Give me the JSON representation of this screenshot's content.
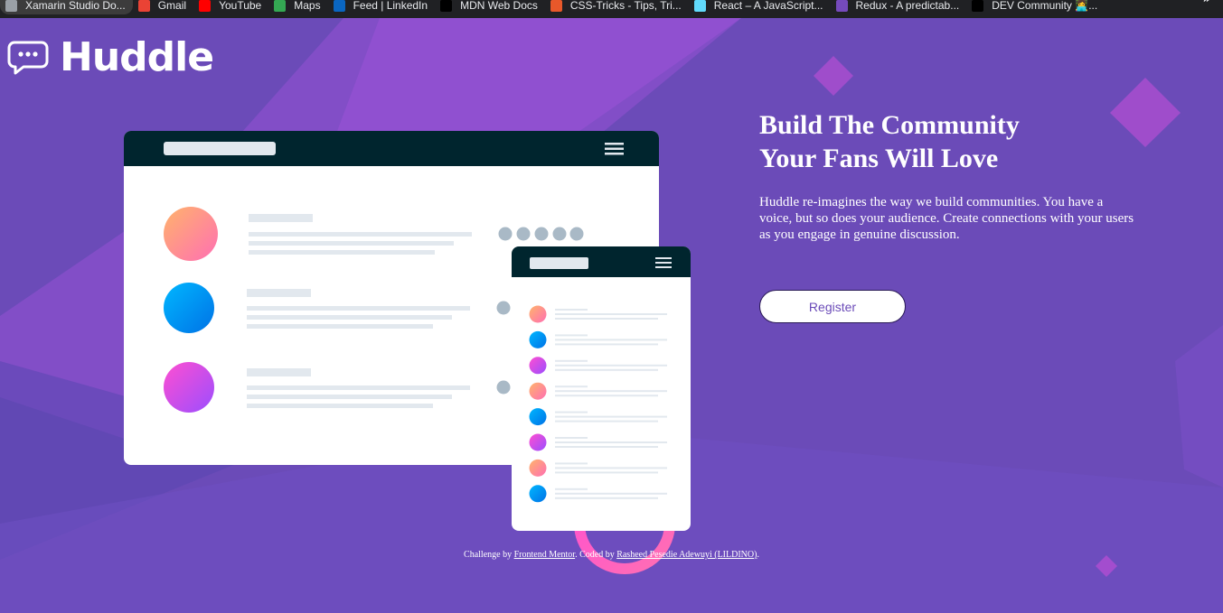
{
  "bookmarks": [
    {
      "label": "Xamarin Studio Do...",
      "icon": "globe-icon",
      "color": "#9aa0a6"
    },
    {
      "label": "Gmail",
      "icon": "gmail-icon",
      "color": "#ea4335"
    },
    {
      "label": "YouTube",
      "icon": "youtube-icon",
      "color": "#ff0000"
    },
    {
      "label": "Maps",
      "icon": "maps-icon",
      "color": "#34a853"
    },
    {
      "label": "Feed | LinkedIn",
      "icon": "linkedin-icon",
      "color": "#0a66c2"
    },
    {
      "label": "MDN Web Docs",
      "icon": "mdn-icon",
      "color": "#000000"
    },
    {
      "label": "CSS-Tricks - Tips, Tri...",
      "icon": "css-tricks-icon",
      "color": "#e8582a"
    },
    {
      "label": "React – A JavaScript...",
      "icon": "react-icon",
      "color": "#61dafb"
    },
    {
      "label": "Redux - A predictab...",
      "icon": "redux-icon",
      "color": "#764abc"
    },
    {
      "label": "DEV Community 👩‍💻...",
      "icon": "dev-icon",
      "color": "#000000"
    }
  ],
  "bookmarks_overflow": "»",
  "logo": {
    "text": "Huddle",
    "icon": "chat-bubble-icon"
  },
  "hero": {
    "title_line1": "Build The Community",
    "title_line2": "Your Fans Will Love",
    "description": "Huddle re-imagines the way we build communities. You have a voice, but so does your audience. Create connections with your users as you engage in genuine discussion.",
    "register_label": "Register"
  },
  "footer": {
    "prefix": "Challenge by ",
    "challenge_link": "Frontend Mentor",
    "middle": ". Coded by ",
    "author_link": "Rasheed Pesedie Adewuyi (LILDINO)",
    "suffix": "."
  },
  "colors": {
    "background": "#6b4bb8",
    "pink_gradient": [
      "#ffb36b",
      "#ff6fb3"
    ],
    "blue_gradient": [
      "#00b7ff",
      "#0072e6"
    ],
    "magenta_gradient": [
      "#ff4fd1",
      "#b44dff"
    ],
    "mockup_header": "#00252e"
  }
}
